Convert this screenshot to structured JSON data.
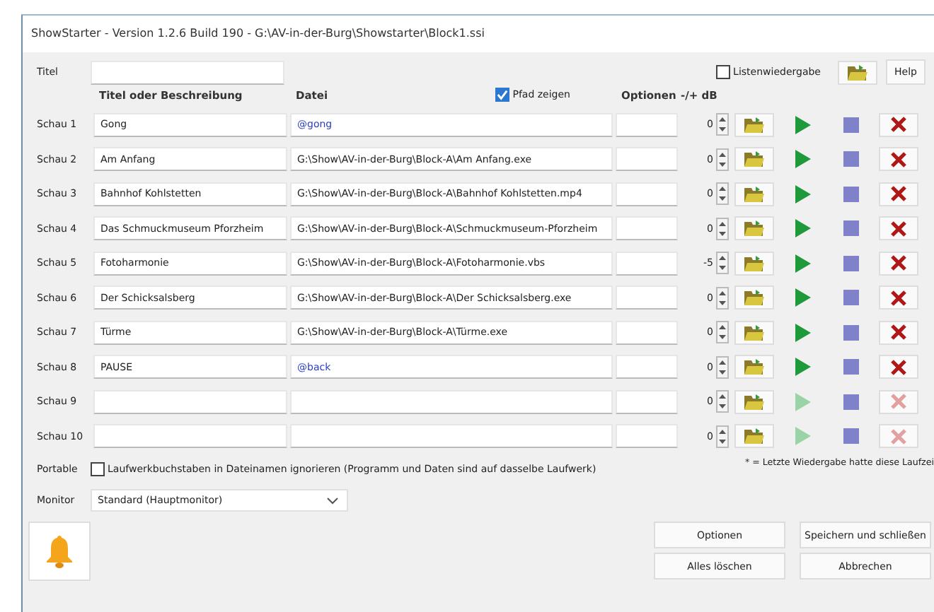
{
  "window": {
    "title": "ShowStarter - Version 1.2.6 Build 190 - G:\\AV-in-der-Burg\\Showstarter\\Block1.ssi"
  },
  "title_field": {
    "label": "Titel"
  },
  "list_playback": {
    "label": "Listenwiedergabe",
    "checked": false
  },
  "help_button": "Help",
  "columns": {
    "title": "Titel oder Beschreibung",
    "file": "Datei",
    "options": "Optionen",
    "db": "-/+ dB"
  },
  "show_path": {
    "label": "Pfad zeigen",
    "checked": true
  },
  "shows": [
    {
      "label": "Schau 1",
      "title": "Gong",
      "file": {
        "text": "@gong",
        "color": "#2a3ec0"
      },
      "db": "0",
      "enabled": true
    },
    {
      "label": "Schau 2",
      "title": "Am Anfang",
      "file": {
        "text": "G:\\Show\\AV-in-der-Burg\\Block-A\\Am Anfang.exe",
        "color": "#222222"
      },
      "db": "0",
      "enabled": true
    },
    {
      "label": "Schau 3",
      "title": "Bahnhof Kohlstetten",
      "file": {
        "text": "G:\\Show\\AV-in-der-Burg\\Block-A\\Bahnhof Kohlstetten.mp4",
        "color": "#222222"
      },
      "db": "0",
      "enabled": true
    },
    {
      "label": "Schau 4",
      "title": "Das Schmuckmuseum Pforzheim",
      "file": {
        "text": "G:\\Show\\AV-in-der-Burg\\Block-A\\Schmuckmuseum-Pforzheim",
        "color": "#222222"
      },
      "db": "0",
      "enabled": true
    },
    {
      "label": "Schau 5",
      "title": "Fotoharmonie",
      "file": {
        "text": "G:\\Show\\AV-in-der-Burg\\Block-A\\Fotoharmonie.vbs",
        "color": "#222222"
      },
      "db": "-5",
      "enabled": true
    },
    {
      "label": "Schau 6",
      "title": "Der Schicksalsberg",
      "file": {
        "text": "G:\\Show\\AV-in-der-Burg\\Block-A\\Der Schicksalsberg.exe",
        "color": "#222222"
      },
      "db": "0",
      "enabled": true
    },
    {
      "label": "Schau 7",
      "title": "Türme",
      "file": {
        "text": "G:\\Show\\AV-in-der-Burg\\Block-A\\Türme.exe",
        "color": "#222222"
      },
      "db": "0",
      "enabled": true
    },
    {
      "label": "Schau 8",
      "title": "PAUSE",
      "file": {
        "text": "@back",
        "color": "#2a3ec0"
      },
      "db": "0",
      "enabled": true
    },
    {
      "label": "Schau 9",
      "db": "0",
      "enabled": false
    },
    {
      "label": "Schau 10",
      "db": "0",
      "enabled": false
    }
  ],
  "footnote": "* = Letzte Wiedergabe hatte diese Laufzei",
  "portable": {
    "label": "Portable",
    "option": "Laufwerkbuchstaben in Dateinamen ignorieren (Programm und Daten sind auf dasselbe Laufwerk)",
    "checked": false
  },
  "monitor": {
    "label": "Monitor",
    "value": "Standard (Hauptmonitor)"
  },
  "buttons": [
    "Optionen",
    "Speichern und schließen",
    "Alles löschen",
    "Abbrechen"
  ]
}
